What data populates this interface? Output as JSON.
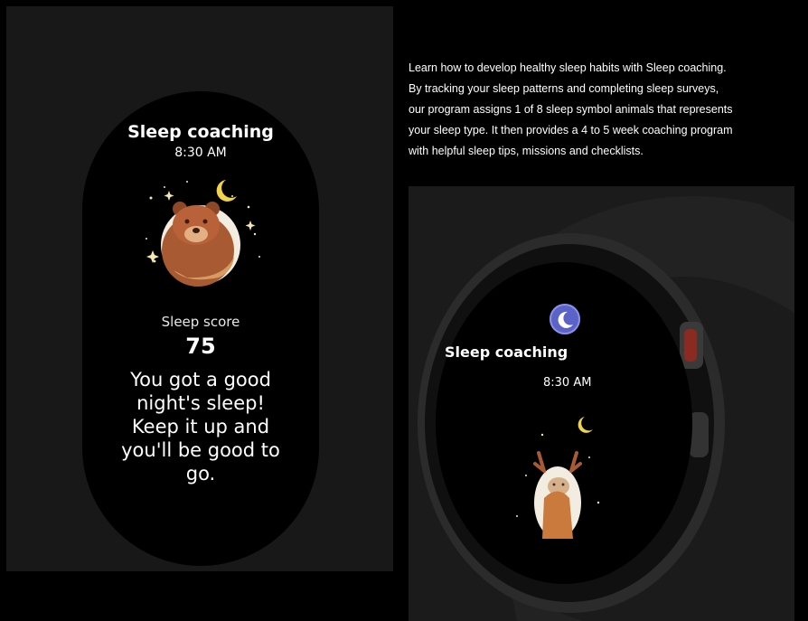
{
  "band": {
    "title": "Sleep coaching",
    "time": "8:30 AM",
    "animal_icon": "bear-icon",
    "score_label": "Sleep score",
    "score": "75",
    "message": "You got a good night's sleep! Keep it up and you'll be good to go."
  },
  "description": {
    "lines": [
      "Learn how to develop healthy sleep habits with Sleep coaching.",
      "By tracking your sleep patterns and completing sleep surveys,",
      "our program assigns 1 of 8 sleep symbol animals that represents",
      "your sleep type. It then provides a 4 to 5 week coaching program",
      "with helpful sleep tips, missions and checklists."
    ]
  },
  "watch": {
    "icon": "moon-icon",
    "title": "Sleep coaching",
    "time": "8:30 AM",
    "animal_icon": "deer-icon"
  },
  "colors": {
    "animal_brown": "#a85a33",
    "animal_tan": "#d79a63",
    "moon_yellow": "#f1d34b",
    "icon_blue": "#5b63c9"
  }
}
